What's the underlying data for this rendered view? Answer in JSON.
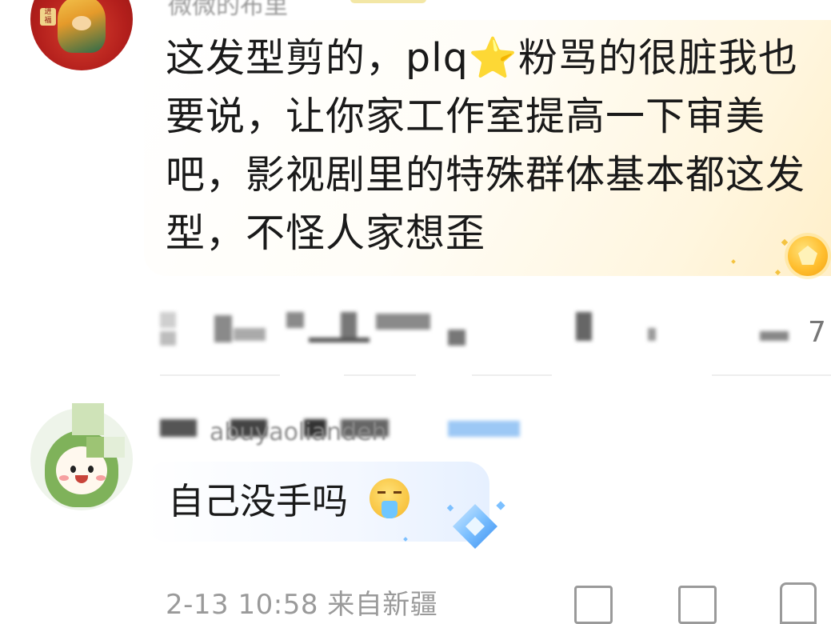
{
  "comments": [
    {
      "username": "微微的布里",
      "text": "这发型剪的，plq⭐粉骂的很脏我也要说，让你家工作室提高一下审美吧，影视剧里的特殊群体基本都这发型，不怪人家想歪",
      "like_count": "7",
      "avatar_icon": "red-deity-avatar-icon",
      "medal_icon": "gold-medal-icon"
    },
    {
      "username": "abuyaoliandeh",
      "text": "自己没手吗",
      "emoji_icon": "vomiting-face-emoji-icon",
      "medal_icon": "blue-gem-medal-icon",
      "meta": "2-13 10:58 来自新疆",
      "avatar_icon": "green-hood-cartoon-avatar-icon"
    }
  ],
  "colors": {
    "gold_bubble": "#fff6df",
    "blue_bubble": "#e6f0ff",
    "muted_text": "#9a9a9a",
    "primary_text": "#1a1a1a"
  }
}
